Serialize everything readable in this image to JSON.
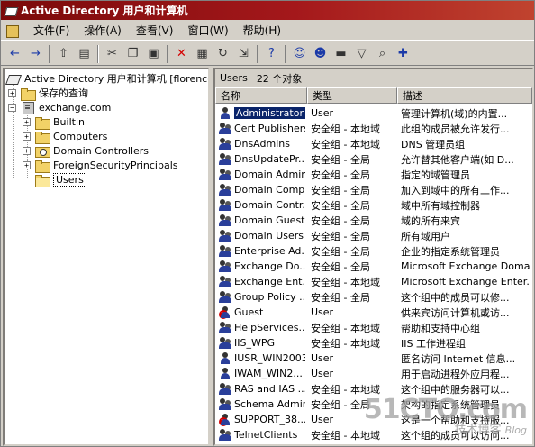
{
  "window": {
    "title": "Active Directory 用户和计算机"
  },
  "menu": [
    "文件(F)",
    "操作(A)",
    "查看(V)",
    "窗口(W)",
    "帮助(H)"
  ],
  "toolbar": [
    "back-icon",
    "forward-icon",
    "sep",
    "up-folder-icon",
    "show-tree-icon",
    "sep",
    "cut-icon",
    "copy-icon",
    "paste-icon",
    "sep",
    "delete-icon",
    "properties-icon",
    "refresh-icon",
    "export-icon",
    "sep",
    "help-icon",
    "sep",
    "new-user-icon",
    "new-group-icon",
    "new-ou-icon",
    "filter-icon",
    "find-icon",
    "add-to-group-icon"
  ],
  "tree": {
    "root": "Active Directory 用户和计算机 [florence.e",
    "saved_queries": "保存的查询",
    "domain": "exchange.com",
    "children": [
      "Builtin",
      "Computers",
      "Domain Controllers",
      "ForeignSecurityPrincipals",
      "Users"
    ],
    "selected": "Users"
  },
  "list": {
    "title": "Users",
    "count": "22 个对象",
    "columns": [
      "名称",
      "类型",
      "描述"
    ],
    "rows": [
      {
        "name": "Administrator",
        "type": "User",
        "desc": "管理计算机(域)的内置...",
        "icon": "user",
        "selected": true
      },
      {
        "name": "Cert Publishers",
        "type": "安全组 - 本地域",
        "desc": "此组的成员被允许发行...",
        "icon": "group"
      },
      {
        "name": "DnsAdmins",
        "type": "安全组 - 本地域",
        "desc": "DNS 管理员组",
        "icon": "group"
      },
      {
        "name": "DnsUpdatePr...",
        "type": "安全组 - 全局",
        "desc": "允许替其他客户端(如 D...",
        "icon": "group"
      },
      {
        "name": "Domain Admins",
        "type": "安全组 - 全局",
        "desc": "指定的域管理员",
        "icon": "group"
      },
      {
        "name": "Domain Comp...",
        "type": "安全组 - 全局",
        "desc": "加入到域中的所有工作...",
        "icon": "group"
      },
      {
        "name": "Domain Contr...",
        "type": "安全组 - 全局",
        "desc": "域中所有域控制器",
        "icon": "group"
      },
      {
        "name": "Domain Guests",
        "type": "安全组 - 全局",
        "desc": "域的所有来宾",
        "icon": "group"
      },
      {
        "name": "Domain Users",
        "type": "安全组 - 全局",
        "desc": "所有域用户",
        "icon": "group"
      },
      {
        "name": "Enterprise Ad...",
        "type": "安全组 - 全局",
        "desc": "企业的指定系统管理员",
        "icon": "group"
      },
      {
        "name": "Exchange Do...",
        "type": "安全组 - 全局",
        "desc": "Microsoft Exchange Domai...",
        "icon": "group"
      },
      {
        "name": "Exchange Ent...",
        "type": "安全组 - 本地域",
        "desc": "Microsoft Exchange Enter...",
        "icon": "group"
      },
      {
        "name": "Group Policy ...",
        "type": "安全组 - 全局",
        "desc": "这个组中的成员可以修...",
        "icon": "group"
      },
      {
        "name": "Guest",
        "type": "User",
        "desc": "供来宾访问计算机或访...",
        "icon": "user-disabled"
      },
      {
        "name": "HelpServices...",
        "type": "安全组 - 本地域",
        "desc": "帮助和支持中心组",
        "icon": "group"
      },
      {
        "name": "IIS_WPG",
        "type": "安全组 - 本地域",
        "desc": "IIS 工作进程组",
        "icon": "group"
      },
      {
        "name": "IUSR_WIN2003",
        "type": "User",
        "desc": "匿名访问 Internet 信息...",
        "icon": "user"
      },
      {
        "name": "IWAM_WIN2...",
        "type": "User",
        "desc": "用于启动进程外应用程...",
        "icon": "user"
      },
      {
        "name": "RAS and IAS ...",
        "type": "安全组 - 本地域",
        "desc": "这个组中的服务器可以...",
        "icon": "group"
      },
      {
        "name": "Schema Admins",
        "type": "安全组 - 全局",
        "desc": "架构的指定系统管理员",
        "icon": "group"
      },
      {
        "name": "SUPPORT_38...",
        "type": "User",
        "desc": "这是一个帮助和支持服...",
        "icon": "user-disabled"
      },
      {
        "name": "TelnetClients",
        "type": "安全组 - 本地域",
        "desc": "这个组的成员可以访问...",
        "icon": "group"
      }
    ]
  },
  "watermark": {
    "main": "51CTO.com",
    "sub": "技术博客",
    "tag": "Blog"
  }
}
